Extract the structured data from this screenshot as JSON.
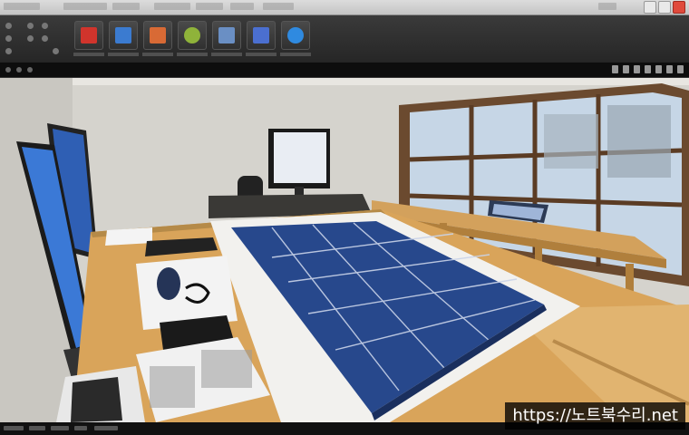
{
  "watermark": {
    "text": "https://노트북수리.net"
  },
  "colors": {
    "ribbon": "#2e2e2e",
    "accent_blue": "#3e66b3",
    "desk_wood": "#d9a45a",
    "mat_blue": "#2b4a8c"
  },
  "ribbon": {
    "tools": [
      {
        "icon": "picture-red-icon",
        "color": "#d0342c"
      },
      {
        "icon": "picture-blue-icon",
        "color": "#3b7bd0"
      },
      {
        "icon": "picture-orange-icon",
        "color": "#d86a35"
      },
      {
        "icon": "target-green-icon",
        "color": "#8fb33a"
      },
      {
        "icon": "window-icon",
        "color": "#6a8fc4"
      },
      {
        "icon": "frame-blue-icon",
        "color": "#4b6fd0"
      },
      {
        "icon": "globe-icon",
        "color": "#2f8ae0"
      }
    ]
  }
}
